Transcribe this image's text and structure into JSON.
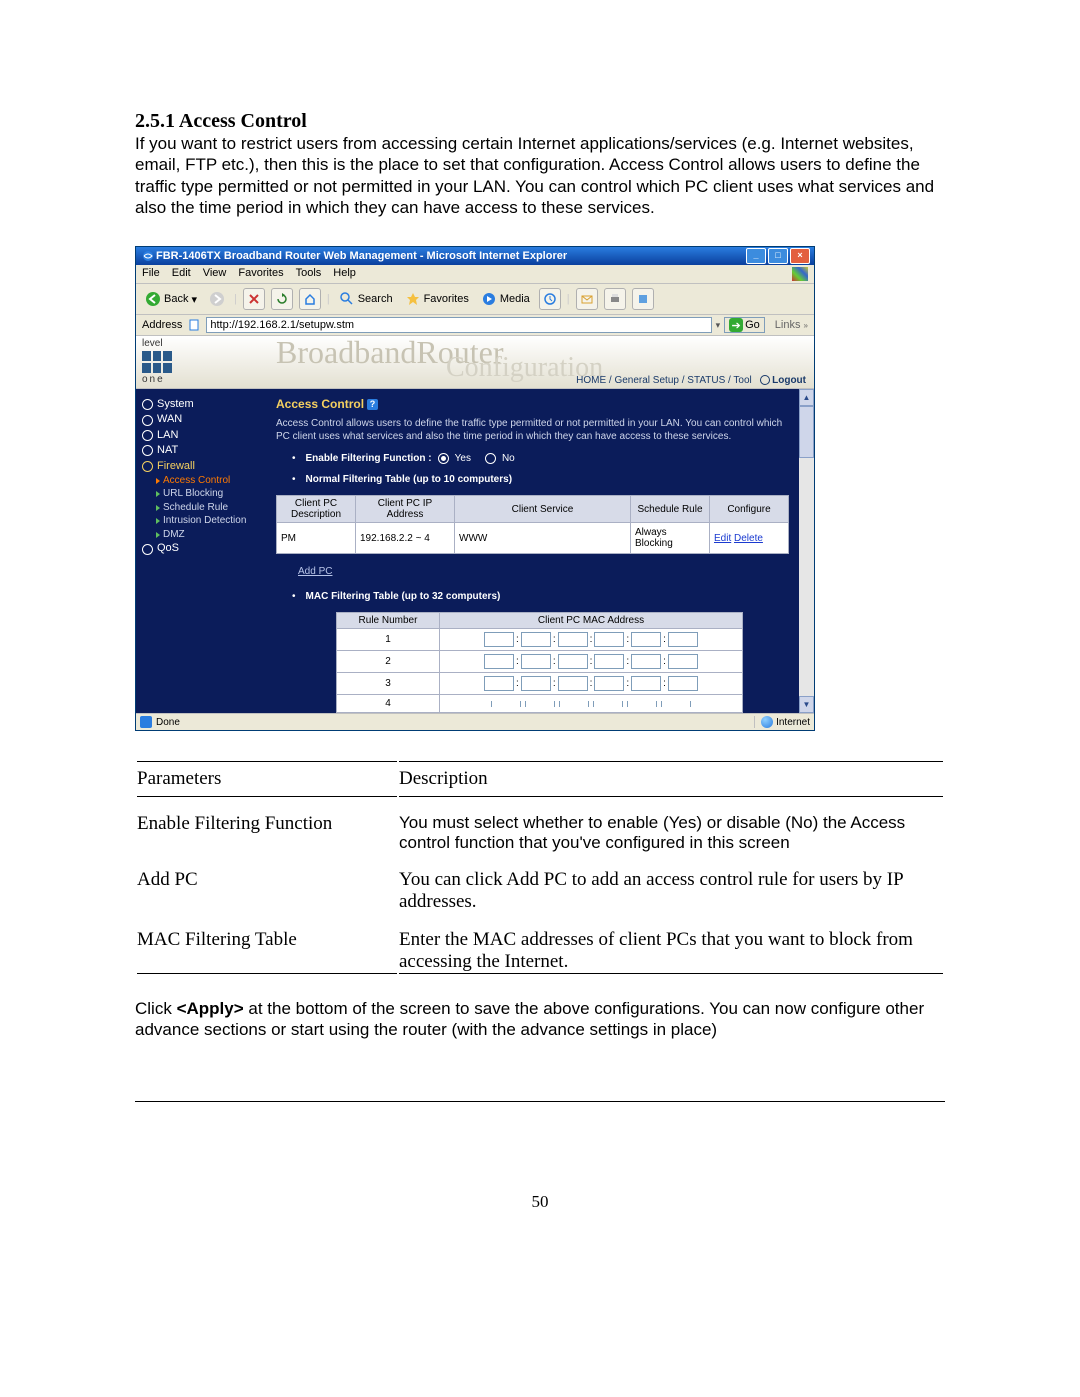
{
  "section": {
    "number": "2.5.1",
    "title": "Access Control"
  },
  "intro": "If you want to restrict users from accessing certain Internet applications/services (e.g. Internet websites, email, FTP etc.), then this is the place to set that configuration. Access Control allows users to define the traffic type permitted or not permitted in your LAN. You can control which PC client uses what services and also the time period in which they can have access to these services.",
  "ie": {
    "title": "FBR-1406TX Broadband Router Web Management - Microsoft Internet Explorer",
    "menus": [
      "File",
      "Edit",
      "View",
      "Favorites",
      "Tools",
      "Help"
    ],
    "back": "Back",
    "search": "Search",
    "favorites": "Favorites",
    "media": "Media",
    "address_label": "Address",
    "url": "http://192.168.2.1/setupw.stm",
    "go": "Go",
    "links": "Links"
  },
  "banner": {
    "logo_top": "level",
    "logo_bottom": "one",
    "big1": "BroadbandRouter",
    "big2": "Configuration",
    "nav": [
      "HOME",
      "General Setup",
      "STATUS",
      "Tool"
    ],
    "logout": "Logout"
  },
  "sidebar": {
    "items": [
      {
        "label": "System"
      },
      {
        "label": "WAN"
      },
      {
        "label": "LAN"
      },
      {
        "label": "NAT"
      },
      {
        "label": "Firewall",
        "active": true,
        "subs": [
          {
            "label": "Access Control",
            "active": true
          },
          {
            "label": "URL Blocking"
          },
          {
            "label": "Schedule Rule"
          },
          {
            "label": "Intrusion Detection"
          },
          {
            "label": "DMZ"
          }
        ]
      },
      {
        "label": "QoS"
      }
    ]
  },
  "content": {
    "title": "Access Control",
    "desc": "Access Control allows users to define the traffic type permitted or not permitted in your LAN. You can control which PC client uses what services and also the time period in which they can have access to these services.",
    "enable_label": "Enable Filtering Function :",
    "yes": "Yes",
    "no": "No",
    "normal_title": "Normal Filtering Table (up to 10 computers)",
    "normal_headers": [
      "Client PC Description",
      "Client PC IP Address",
      "Client Service",
      "Schedule Rule",
      "Configure"
    ],
    "normal_row": {
      "desc": "PM",
      "ip": "192.168.2.2 ~ 4",
      "service": "WWW",
      "rule": "Always Blocking",
      "edit": "Edit",
      "delete": "Delete"
    },
    "add_pc": "Add PC",
    "mac_title": "MAC Filtering Table (up to 32 computers)",
    "mac_headers": [
      "Rule Number",
      "Client PC MAC Address"
    ],
    "mac_rows": [
      "1",
      "2",
      "3",
      "4"
    ]
  },
  "status": {
    "done": "Done",
    "zone": "Internet"
  },
  "params": {
    "header_left": "Parameters",
    "header_right": "Description",
    "rows": [
      {
        "p": "Enable Filtering Function",
        "d": "You must select whether to enable (Yes) or disable (No) the Access control function that you've configured in this screen"
      },
      {
        "p": "Add PC",
        "d": "You can click Add PC to add an access control rule for users by IP addresses."
      },
      {
        "p": "MAC Filtering Table",
        "d": "Enter the MAC addresses of client PCs that you want to block from accessing the Internet."
      }
    ]
  },
  "footer": "Click <Apply> at the bottom of the screen to save the above configurations. You can now configure other advance sections or start using the router (with the advance settings in place)",
  "page_number": "50"
}
